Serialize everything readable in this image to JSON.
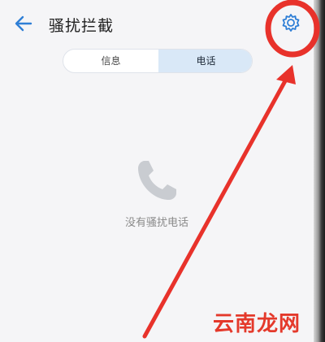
{
  "header": {
    "title": "骚扰拦截",
    "back_icon": "arrow-left-icon",
    "settings_icon": "gear-icon"
  },
  "tabs": [
    {
      "label": "信息",
      "selected": false
    },
    {
      "label": "电话",
      "selected": true
    }
  ],
  "empty_state": {
    "icon": "phone-handset-icon",
    "text": "没有骚扰电话"
  },
  "annotation": {
    "color": "#e8322b",
    "shape": "red circle around settings gear with arrow pointing to it"
  },
  "watermark": "云南龙网",
  "colors": {
    "accent": "#2f7fd6",
    "selected_tab_bg": "#d9e8f7",
    "annotation_red": "#e8322b"
  }
}
